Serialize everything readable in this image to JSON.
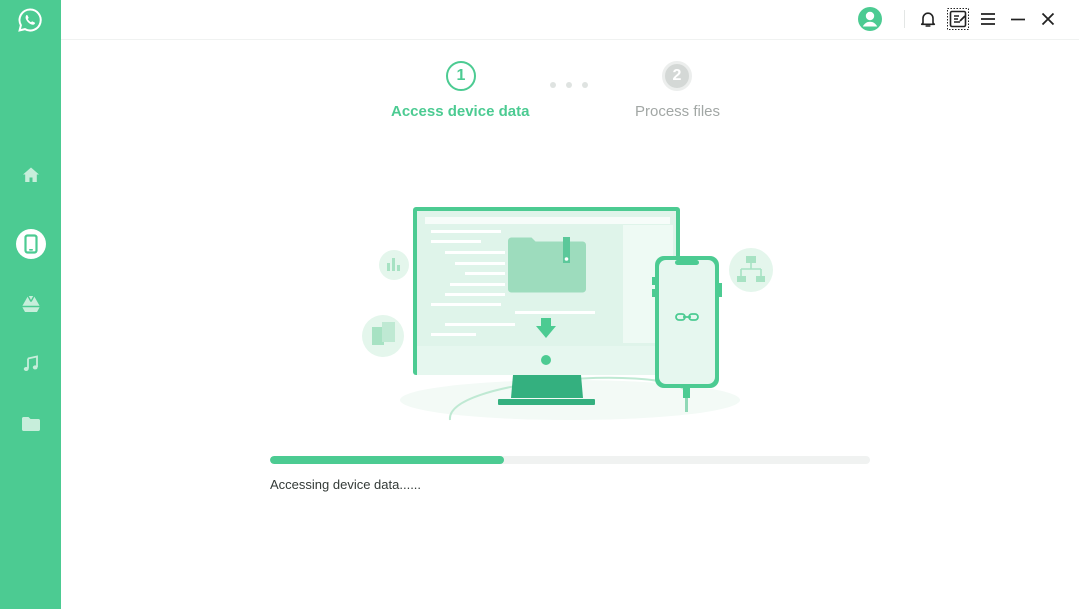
{
  "colors": {
    "accent": "#4ccb92",
    "sidebar": "#4ccb92",
    "muted": "#a2a7a5",
    "track": "#f0f2f1"
  },
  "sidebar": {
    "logo_icon": "whatsapp-logo-icon",
    "items": [
      {
        "icon": "home-icon",
        "active": false
      },
      {
        "icon": "phone-device-icon",
        "active": true
      },
      {
        "icon": "google-drive-icon",
        "active": false
      },
      {
        "icon": "music-note-icon",
        "active": false
      },
      {
        "icon": "folder-icon",
        "active": false
      }
    ]
  },
  "titlebar": {
    "icons": [
      "user-avatar-icon",
      "bell-icon",
      "feedback-edit-icon",
      "menu-icon",
      "minimize-icon",
      "close-icon"
    ]
  },
  "steps": [
    {
      "number": "1",
      "label": "Access device data",
      "state": "active"
    },
    {
      "number": "2",
      "label": "Process files",
      "state": "pending"
    }
  ],
  "progress": {
    "percent": 39,
    "status_text": "Accessing device data......"
  }
}
